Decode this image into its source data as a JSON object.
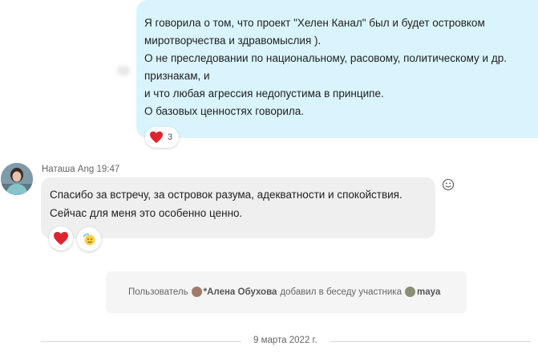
{
  "outgoing_message": {
    "lines": [
      "Я говорила о том, что проект \"Хелен Канал\" был и будет островком",
      "миротворчества и здравомыслия ).",
      "О не преследовании по национальному, расовому, политическому и др.",
      "признакам, и",
      "и что любая агрессия недопустима в принципе.",
      "О базовых ценностях говорила."
    ],
    "reaction": {
      "icon": "heart-icon",
      "count": "3"
    }
  },
  "incoming_message": {
    "sender": "Наташа Ang",
    "time": "19:47",
    "lines": [
      "Спасибо за встречу, за островок разума, адекватности и спокойствия.",
      "Сейчас для меня это особенно ценно."
    ],
    "reactions": [
      "heart-icon",
      "sun-smile-icon"
    ]
  },
  "system_message": {
    "prefix": "Пользователь",
    "user1": "*Алена Обухова",
    "middle": "добавил в беседу участника",
    "user2": "maya"
  },
  "date_separator": "9 марта 2022 г.",
  "colors": {
    "outgoing_bubble": "#d9f4fd",
    "incoming_bubble": "#efefef",
    "heart": "#e0242f"
  }
}
